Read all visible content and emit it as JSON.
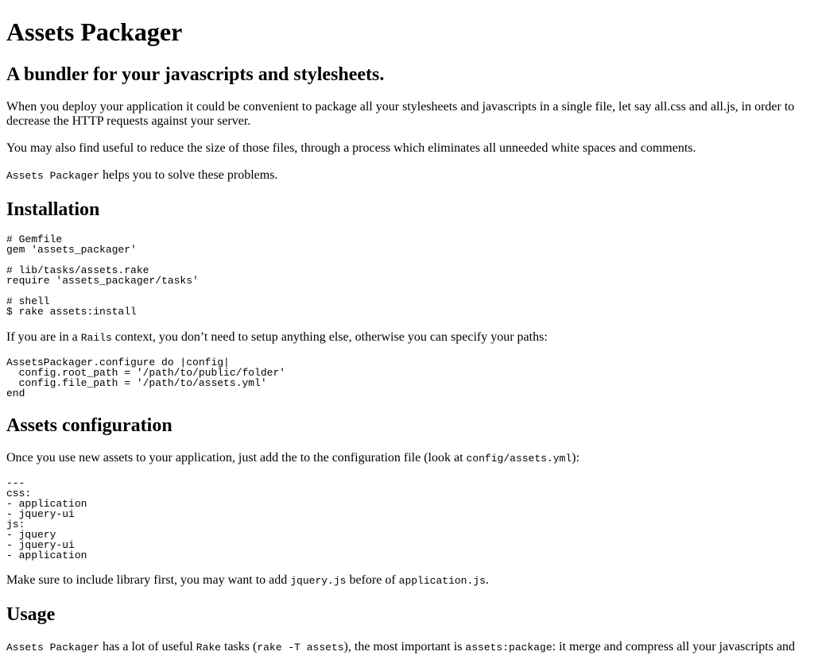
{
  "title": "Assets Packager",
  "subtitle": "A bundler for your javascripts and stylesheets.",
  "intro": {
    "p1": "When you deploy your application it could be convenient to package all your stylesheets and javascripts in a single file, let say all.css and all.js, in order to decrease the HTTP requests against your server.",
    "p2": "You may also find useful to reduce the size of those files, through a process which eliminates all unneeded white spaces and comments.",
    "p3_code": "Assets Packager",
    "p3_text": " helps you to solve these problems."
  },
  "installation": {
    "heading": "Installation",
    "code": "# Gemfile\ngem 'assets_packager'\n\n# lib/tasks/assets.rake\nrequire 'assets_packager/tasks'\n\n# shell\n$ rake assets:install",
    "para_before": "If you are in a ",
    "para_code": "Rails",
    "para_after": " context, you don’t need to setup anything else, otherwise you can specify your paths:",
    "config_code": "AssetsPackager.configure do |config|\n  config.root_path = '/path/to/public/folder'\n  config.file_path = '/path/to/assets.yml'\nend"
  },
  "assets_config": {
    "heading": "Assets configuration",
    "para_before": "Once you use new assets to your application, just add the to the configuration file (look at ",
    "para_code": "config/assets.yml",
    "para_after": "):",
    "yaml": "---\ncss:\n- application\n- jquery-ui\njs:\n- jquery\n- jquery-ui\n- application",
    "note_before": "Make sure to include library first, you may want to add ",
    "note_code1": "jquery.js",
    "note_mid": " before of ",
    "note_code2": "application.js",
    "note_after": "."
  },
  "usage": {
    "heading": "Usage",
    "code1": "Assets Packager",
    "text1": " has a lot of useful ",
    "code2": "Rake",
    "text2": " tasks (",
    "code3": "rake -T assets",
    "text3": "), the most important is ",
    "code4": "assets:package",
    "text4": ": it merge and compress all your javascripts and"
  }
}
